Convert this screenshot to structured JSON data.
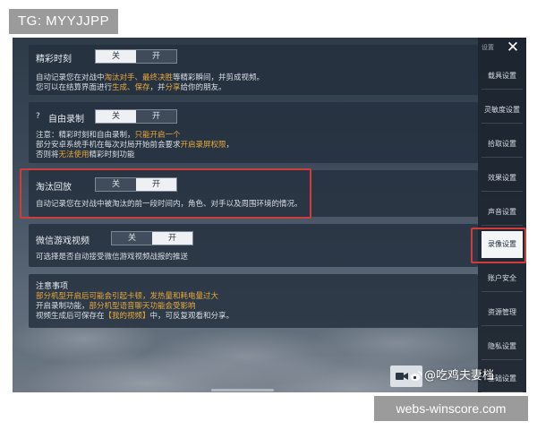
{
  "tag": "TG: MYYJJPP",
  "footer_site": "webs-winscore.com",
  "toggle": {
    "off": "关",
    "on": "开"
  },
  "sections": {
    "highlight": {
      "title": "精彩时刻",
      "state": "off",
      "line1_a": "自动记录您在对战中",
      "line1_b": "淘汰对手、最终决胜",
      "line1_c": "等精彩瞬间，并剪成视频。",
      "line2_a": "您可以在结算界面进行",
      "line2_b": "生成、保存",
      "line2_c": "，并",
      "line2_d": "分享",
      "line2_e": "给你的朋友。"
    },
    "free_record": {
      "icon": "?",
      "title": "自由录制",
      "state": "off",
      "line1_a": "注意：精彩时刻和自由录制，",
      "line1_b": "只能开启一个",
      "line2_a": "部分安卓系统手机在每次对局开始前会要求",
      "line2_b": "开启录屏权限",
      "line2_c": "，",
      "line3_a": "否则将",
      "line3_b": "无法使用",
      "line3_c": "精彩时刻功能"
    },
    "elimination_replay": {
      "title": "淘汰回放",
      "state": "on",
      "line1": "自动记录您在对战中被淘汰的前一段时间内，角色、对手以及周围环境的情况。"
    },
    "wechat_video": {
      "title": "微信游戏视频",
      "state": "on",
      "line1": "可选择是否自动接受微信游戏视频战报的推送"
    },
    "notes": {
      "title": "注意事项",
      "line1": "部分机型开启后可能会引起卡顿，发热量和耗电量过大",
      "line2_a": "开启录制功能，",
      "line2_b": "部分机型语音聊天功能会受影响",
      "line3_a": "视频生成后可保存在",
      "line3_b": "【我的视频】",
      "line3_c": "中，可反复观看和分享。"
    }
  },
  "sidebar": {
    "top_label": "设置",
    "items": [
      {
        "label": "载具设置"
      },
      {
        "label": "灵敏度设置"
      },
      {
        "label": "拾取设置"
      },
      {
        "label": "效果设置"
      },
      {
        "label": "声音设置"
      },
      {
        "label": "录像设置",
        "active": true
      },
      {
        "label": "账户安全"
      },
      {
        "label": "资源管理"
      },
      {
        "label": "隐私设置"
      },
      {
        "label": "基础设置"
      }
    ]
  },
  "watermark": "@吃鸡夫妻档"
}
